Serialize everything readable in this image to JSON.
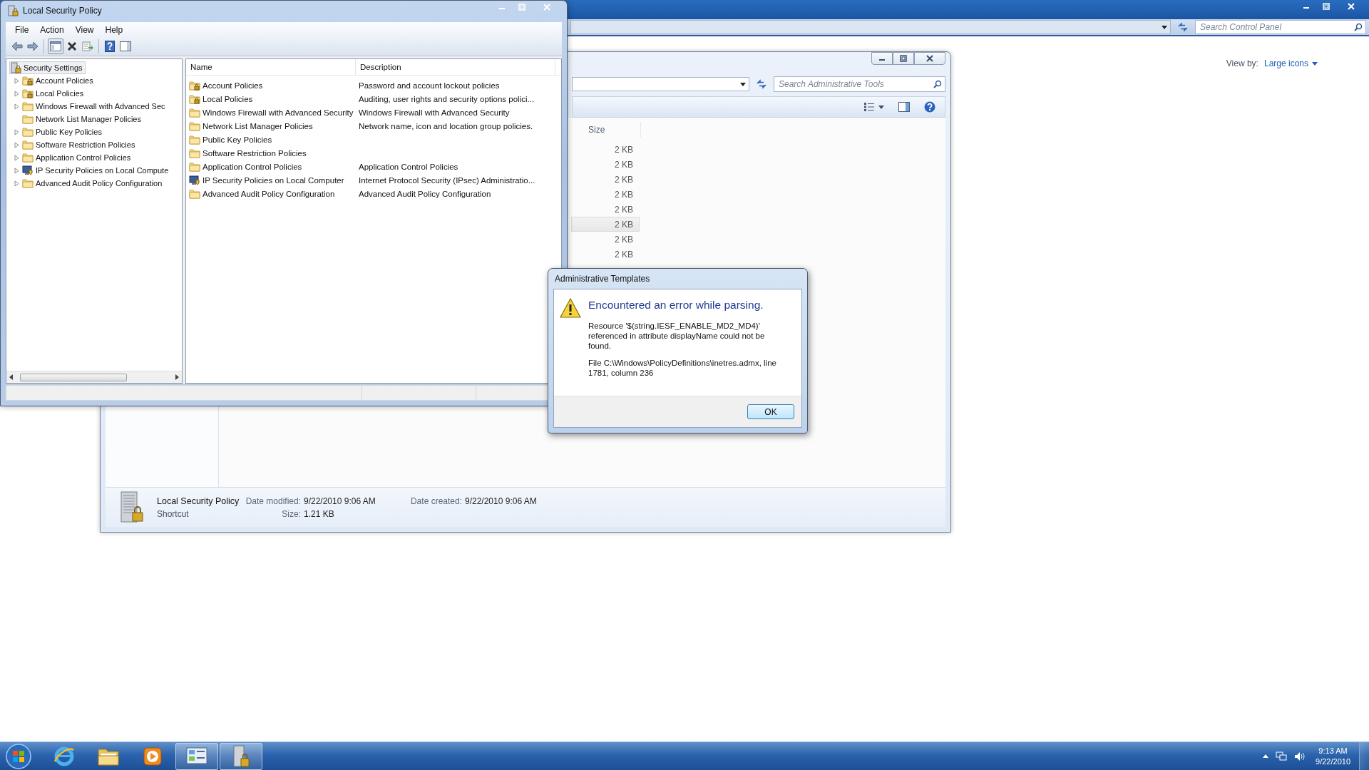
{
  "desktop_window": {
    "search": {
      "placeholder": "Search Control Panel"
    },
    "view_by": {
      "label": "View by:",
      "value": "Large icons"
    }
  },
  "explorer_window": {
    "search": {
      "placeholder": "Search Administrative Tools"
    },
    "columns": [
      "Size"
    ],
    "rows": [
      {
        "size": "2 KB",
        "highlighted": false
      },
      {
        "size": "2 KB",
        "highlighted": false
      },
      {
        "size": "2 KB",
        "highlighted": false
      },
      {
        "size": "2 KB",
        "highlighted": false
      },
      {
        "size": "2 KB",
        "highlighted": false
      },
      {
        "size": "2 KB",
        "highlighted": true
      },
      {
        "size": "2 KB",
        "highlighted": false
      },
      {
        "size": "2 KB",
        "highlighted": false
      }
    ],
    "details": {
      "name": "Local Security Policy",
      "type": "Shortcut",
      "fields": [
        {
          "label": "Date modified:",
          "value": "9/22/2010 9:06 AM"
        },
        {
          "label": "Size:",
          "value": "1.21 KB"
        },
        {
          "label": "Date created:",
          "value": "9/22/2010 9:06 AM"
        }
      ]
    }
  },
  "lsp_window": {
    "title": "Local Security Policy",
    "menu": [
      "File",
      "Action",
      "View",
      "Help"
    ],
    "tree": {
      "label": "Security Settings",
      "selected": true,
      "children": [
        {
          "label": "Account Policies",
          "kind": "locked",
          "expander": true,
          "selected": false
        },
        {
          "label": "Local Policies",
          "kind": "locked",
          "expander": true,
          "selected": false
        },
        {
          "label": "Windows Firewall with Advanced Sec",
          "kind": "plain",
          "expander": true,
          "selected": false
        },
        {
          "label": "Network List Manager Policies",
          "kind": "plain",
          "expander": false,
          "selected": false
        },
        {
          "label": "Public Key Policies",
          "kind": "plain",
          "expander": true,
          "selected": false
        },
        {
          "label": "Software Restriction Policies",
          "kind": "plain",
          "expander": true,
          "selected": false
        },
        {
          "label": "Application Control Policies",
          "kind": "plain",
          "expander": true,
          "selected": false
        },
        {
          "label": "IP Security Policies on Local Compute",
          "kind": "secure",
          "expander": true,
          "selected": false
        },
        {
          "label": "Advanced Audit Policy Configuration",
          "kind": "plain",
          "expander": true,
          "selected": false
        }
      ]
    },
    "list": {
      "columns": [
        "Name",
        "Description"
      ],
      "rows": [
        {
          "name": "Account Policies",
          "description": "Password and account lockout policies",
          "kind": "locked"
        },
        {
          "name": "Local Policies",
          "description": "Auditing, user rights and security options polici...",
          "kind": "locked"
        },
        {
          "name": "Windows Firewall with Advanced Security",
          "description": "Windows Firewall with Advanced Security",
          "kind": "plain"
        },
        {
          "name": "Network List Manager Policies",
          "description": "Network name, icon and location group policies.",
          "kind": "plain"
        },
        {
          "name": "Public Key Policies",
          "kind": "plain"
        },
        {
          "name": "Software Restriction Policies",
          "kind": "plain"
        },
        {
          "name": "Application Control Policies",
          "description": "Application Control Policies",
          "kind": "plain"
        },
        {
          "name": "IP Security Policies on Local Computer",
          "description": "Internet Protocol Security (IPsec) Administratio...",
          "kind": "secure"
        },
        {
          "name": "Advanced Audit Policy Configuration",
          "description": "Advanced Audit Policy Configuration",
          "kind": "plain"
        }
      ]
    }
  },
  "dialog": {
    "title": "Administrative Templates",
    "heading": "Encountered an error while parsing.",
    "message": "Resource '$(string.IESF_ENABLE_MD2_MD4)' referenced in attribute displayName could not be found.",
    "location": "File C:\\Windows\\PolicyDefinitions\\inetres.admx, line 1781, column 236",
    "buttons": [
      "OK"
    ]
  },
  "taskbar": {
    "apps": [
      {
        "kind": "browser",
        "active": false
      },
      {
        "kind": "folder",
        "active": false
      },
      {
        "kind": "media",
        "active": false
      },
      {
        "kind": "control-panel",
        "active": true
      },
      {
        "kind": "security-policy",
        "active": true
      }
    ],
    "clock": {
      "time": "9:13 AM",
      "date": "9/22/2010"
    }
  }
}
